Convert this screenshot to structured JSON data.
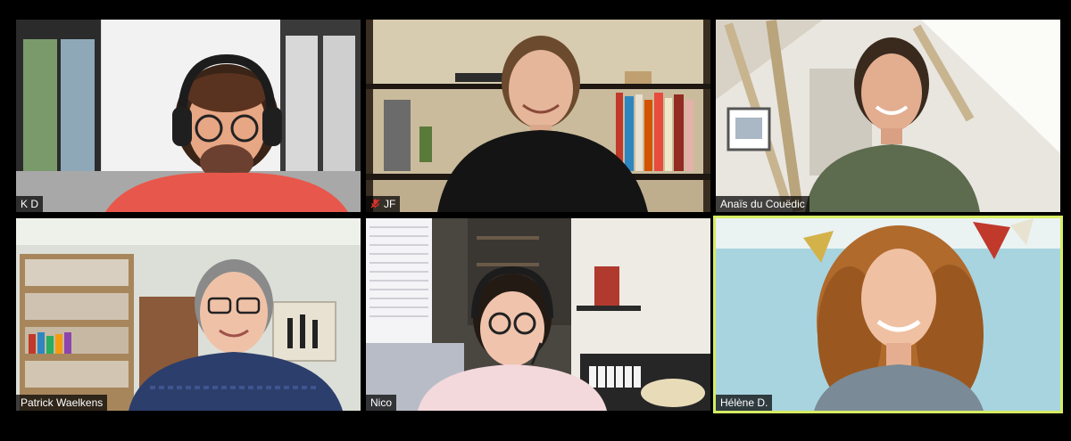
{
  "participants": [
    {
      "name": "K D",
      "muted": false,
      "speaking": false
    },
    {
      "name": "JF",
      "muted": true,
      "speaking": false
    },
    {
      "name": "Anaïs du Couëdic",
      "muted": false,
      "speaking": false
    },
    {
      "name": "Patrick Waelkens",
      "muted": false,
      "speaking": false
    },
    {
      "name": "Nico",
      "muted": false,
      "speaking": false
    },
    {
      "name": "Hélène D.",
      "muted": false,
      "speaking": true
    }
  ],
  "colors": {
    "background": "#000000",
    "active_speaker_border": "#d6ec63",
    "muted_icon": "#e0312b"
  }
}
